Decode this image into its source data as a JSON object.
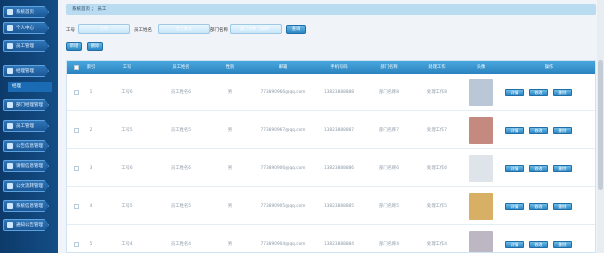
{
  "sidebar": {
    "items": [
      {
        "label": "系统首页",
        "icon": "home-icon"
      },
      {
        "label": "个人中心",
        "icon": "user-icon"
      },
      {
        "label": "员工管理",
        "icon": "people-icon"
      },
      {
        "label": "经理管理",
        "icon": "manager-icon"
      },
      {
        "label": "部门经理管理",
        "icon": "grid-icon"
      },
      {
        "label": "员工管理",
        "icon": "grid-icon"
      },
      {
        "label": "公告信息管理",
        "icon": "grid-icon"
      },
      {
        "label": "请假信息管理",
        "icon": "grid-icon"
      },
      {
        "label": "公文流转管理",
        "icon": "grid-icon"
      },
      {
        "label": "系统信息管理",
        "icon": "grid-icon"
      },
      {
        "label": "通知公告管理",
        "icon": "grid-icon"
      }
    ],
    "sub_item": "经理"
  },
  "breadcrumb": "系统首页 ； 员工",
  "filters": {
    "f1_label": "工号",
    "f1_placeholder": "工号",
    "f2_label": "员工姓名",
    "f2_placeholder": "员工姓名",
    "f3_label": "部门名称",
    "f3_placeholder": "部门名称（选择）",
    "search_label": "查询"
  },
  "actions": {
    "add": "新增",
    "delete": "删除"
  },
  "table": {
    "headers": [
      "",
      "索引",
      "工号",
      "员工姓名",
      "性别",
      "邮箱",
      "手机号码",
      "部门名称",
      "处理工作",
      "头像",
      "操作"
    ],
    "rows": [
      {
        "index": "1",
        "no": "工号6",
        "name": "员工姓名6",
        "gender": "男",
        "email": "773890966@qq.com",
        "phone": "13823888888",
        "dept": "部门名称8",
        "work": "处理工作8",
        "photo_color": "#b9c7d6"
      },
      {
        "index": "2",
        "no": "工号5",
        "name": "员工姓名5",
        "gender": "男",
        "email": "773890967@qq.com",
        "phone": "13823888887",
        "dept": "部门名称7",
        "work": "处理工作7",
        "photo_color": "#c48a7f"
      },
      {
        "index": "3",
        "no": "工号6",
        "name": "员工姓名6",
        "gender": "男",
        "email": "773890906@qq.com",
        "phone": "13823888886",
        "dept": "部门名称6",
        "work": "处理工作6",
        "photo_color": "#dfe3ea"
      },
      {
        "index": "4",
        "no": "工号5",
        "name": "员工姓名5",
        "gender": "男",
        "email": "773890905@qq.com",
        "phone": "13823888885",
        "dept": "部门名称5",
        "work": "处理工作5",
        "photo_color": "#d7b066"
      },
      {
        "index": "5",
        "no": "工号4",
        "name": "员工姓名4",
        "gender": "男",
        "email": "773890904@qq.com",
        "phone": "13823888884",
        "dept": "部门名称4",
        "work": "处理工作4",
        "photo_color": "#bdb7c4"
      }
    ],
    "op_labels": [
      "详情",
      "修改",
      "删除"
    ]
  }
}
